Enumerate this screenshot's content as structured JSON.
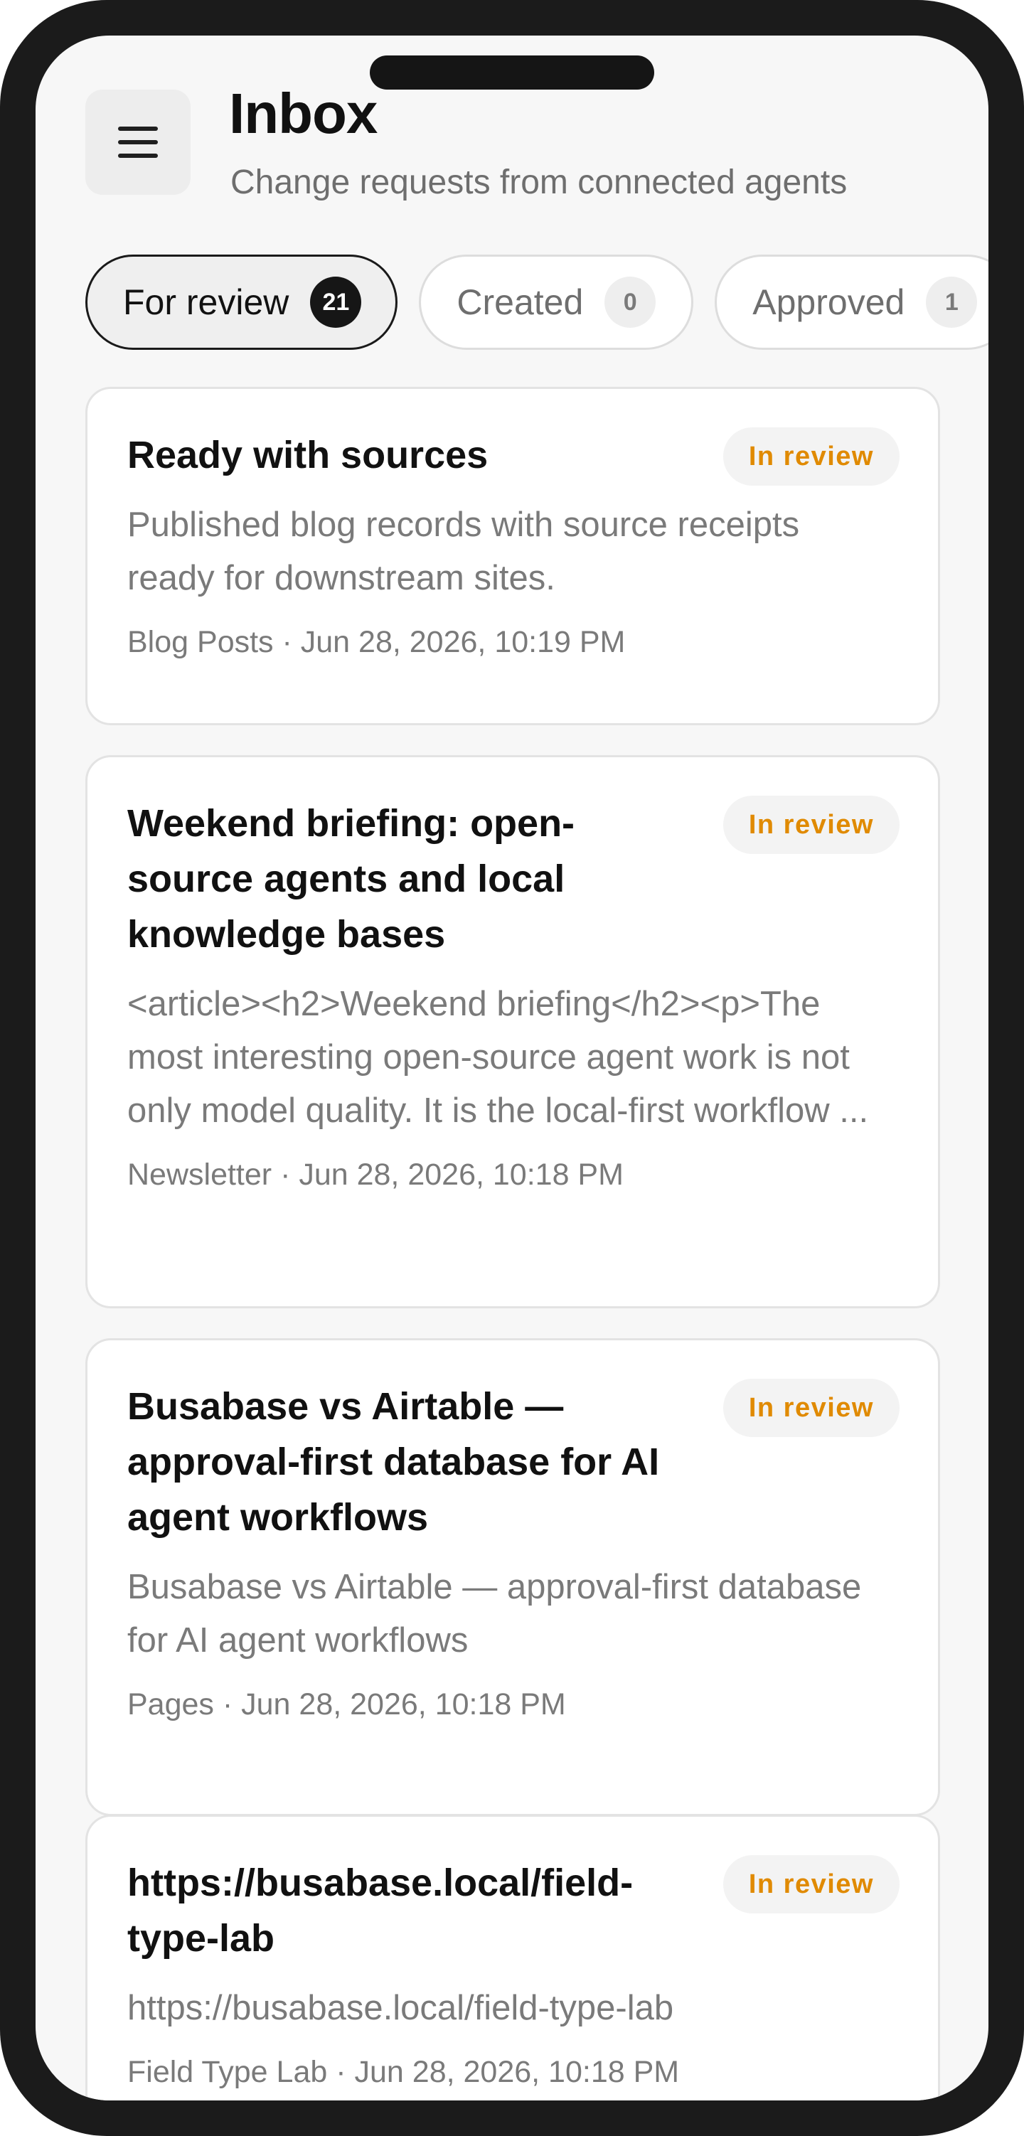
{
  "header": {
    "title": "Inbox",
    "subtitle": "Change requests from connected agents"
  },
  "icons": {
    "menu": "hamburger-menu-icon"
  },
  "tabs": [
    {
      "label": "For review",
      "count": "21",
      "active": true
    },
    {
      "label": "Created",
      "count": "0",
      "active": false
    },
    {
      "label": "Approved",
      "count": "1",
      "active": false
    }
  ],
  "colors": {
    "badge_text": "#e08a00",
    "active_tab_border": "#1a1a1a",
    "active_count_bg": "#161616"
  },
  "cards": [
    {
      "title": "Ready with sources",
      "status": "In review",
      "description": "Published blog records with source receipts ready for downstream sites.",
      "meta": "Blog Posts · Jun 28, 2026, 10:19 PM"
    },
    {
      "title": "Weekend briefing: open-source agents and local knowledge bases",
      "status": "In review",
      "description": "<article><h2>Weekend briefing</h2><p>The most interesting open-source agent work is not only model quality. It is the local-first workflow ...",
      "meta": "Newsletter · Jun 28, 2026, 10:18 PM"
    },
    {
      "title": "Busabase vs Airtable — approval-first database for AI agent workflows",
      "status": "In review",
      "description": "Busabase vs Airtable — approval-first database for AI agent workflows",
      "meta": "Pages · Jun 28, 2026, 10:18 PM"
    },
    {
      "title": "https://busabase.local/field-type-lab",
      "status": "In review",
      "description": "https://busabase.local/field-type-lab",
      "meta": "Field Type Lab · Jun 28, 2026, 10:18 PM"
    }
  ]
}
